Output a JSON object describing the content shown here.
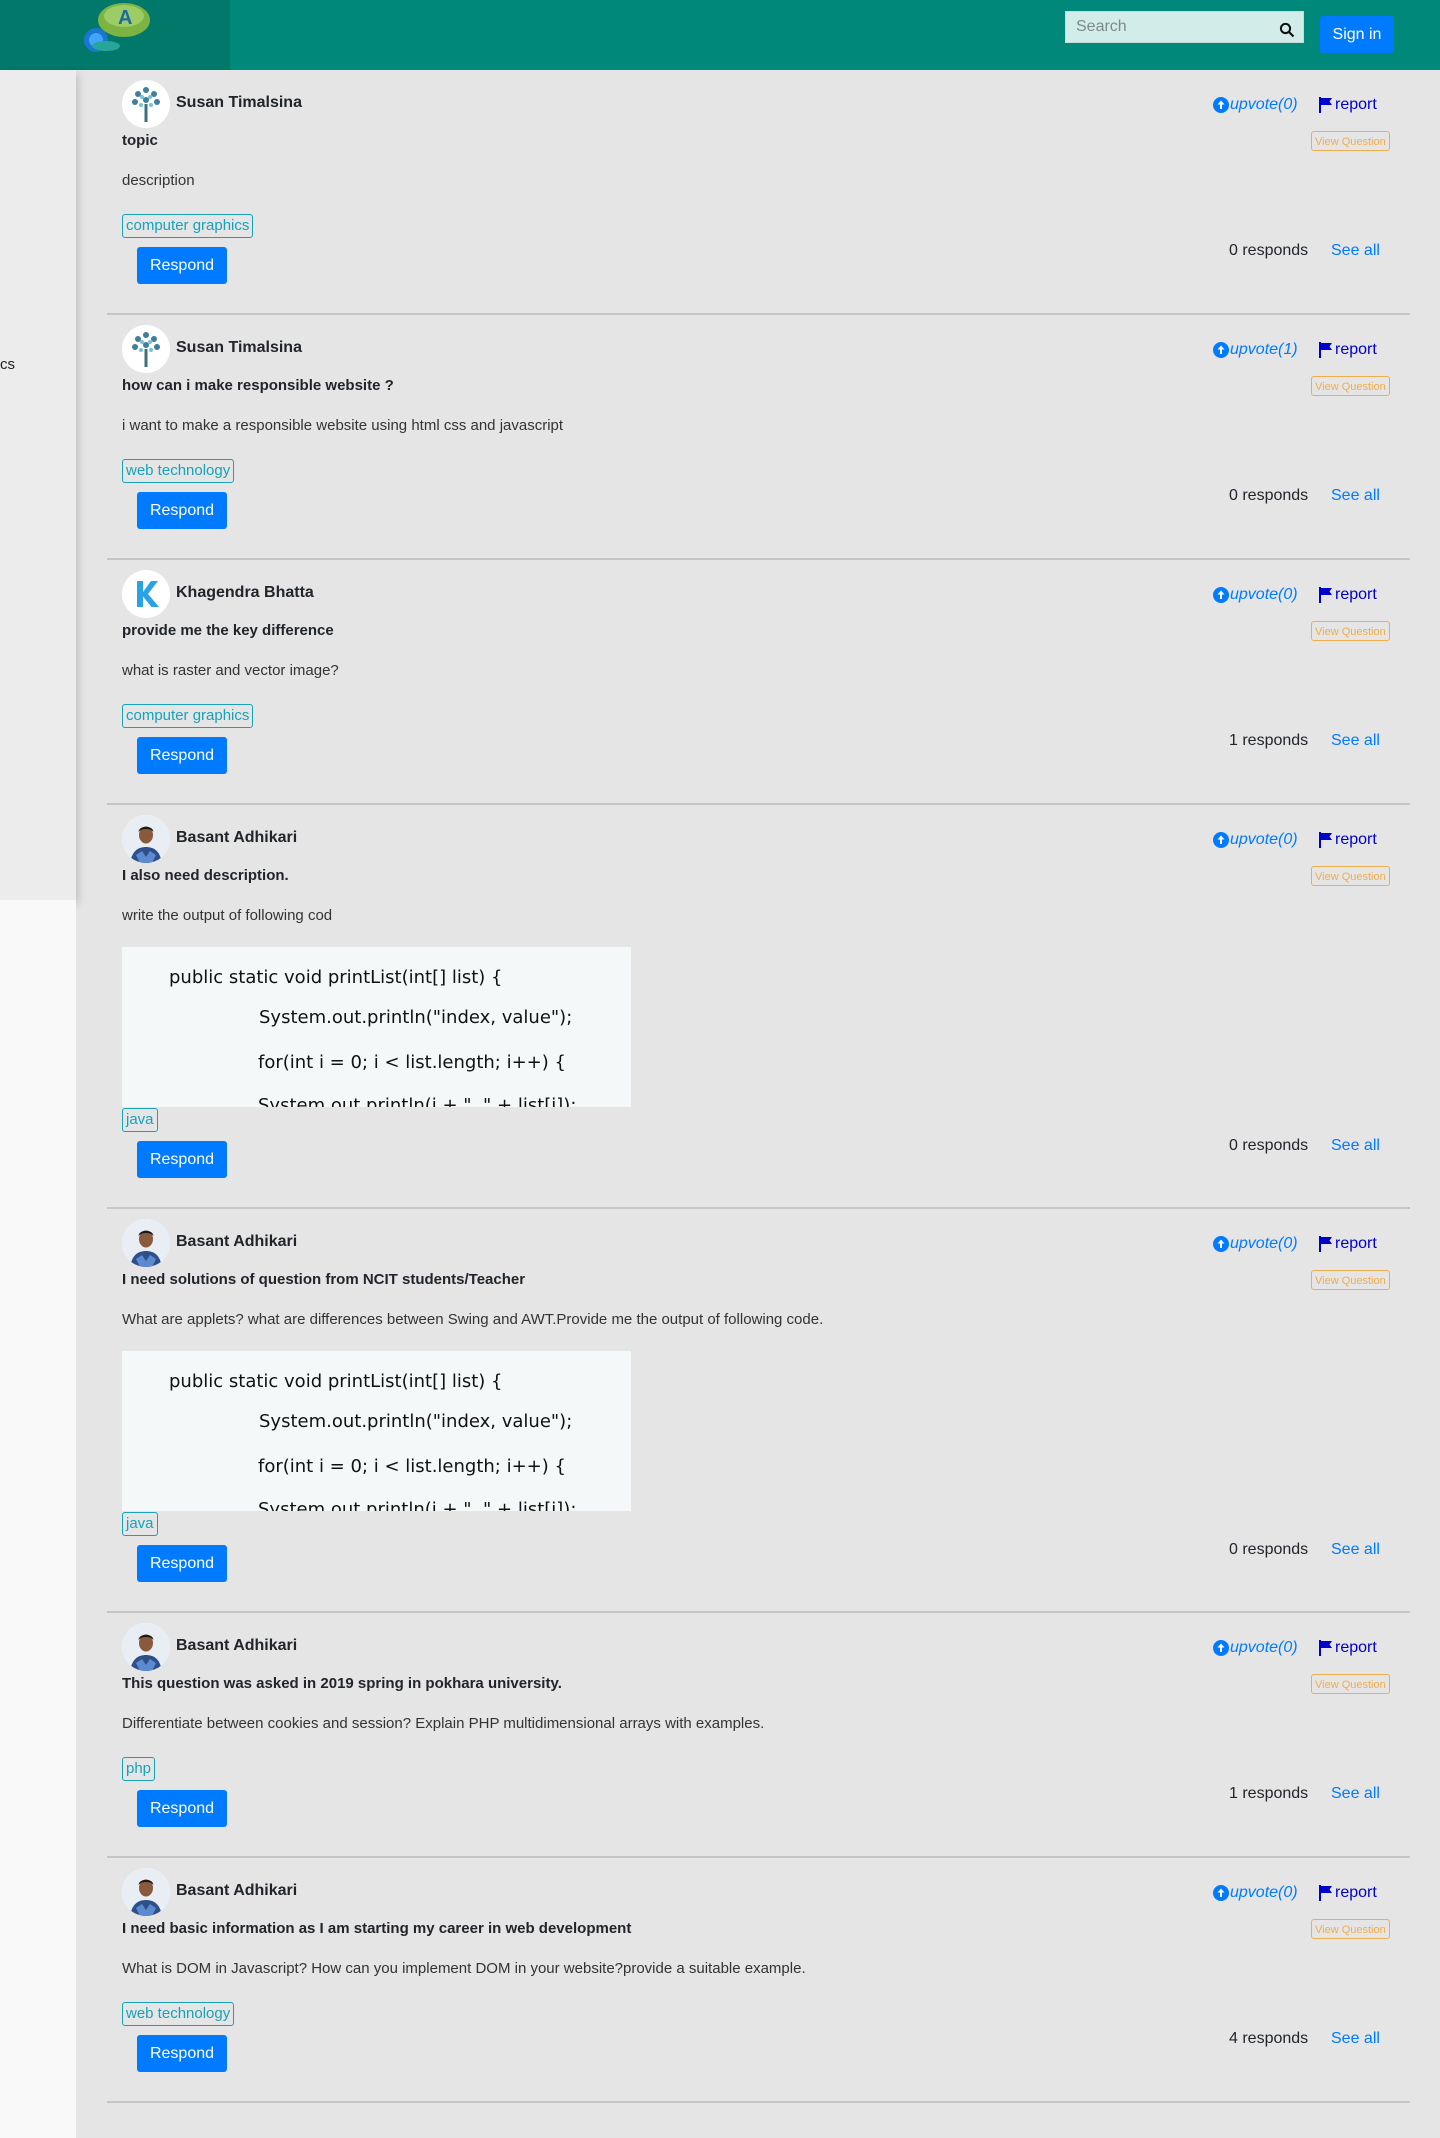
{
  "header": {
    "search_placeholder": "Search",
    "signin_label": "Sign in",
    "accent_color": "#00897b"
  },
  "sidebar": {
    "partial_text": "cs"
  },
  "code_image": {
    "lines": [
      "public static void printList(int[] list) {",
      "System.out.println(\"index, value\");",
      "for(int i = 0; i < list.length; i++) {",
      "System.out.println(i + \", \" + list[i]);"
    ]
  },
  "posts": [
    {
      "author": "Susan Timalsina",
      "upvote": "upvote(0)",
      "report": "report",
      "view": "View Question",
      "title": "topic",
      "description": "description",
      "tag": "computer graphics",
      "respond": "Respond",
      "responds": "0 responds",
      "see_all": "See all"
    },
    {
      "author": "Susan Timalsina",
      "upvote": "upvote(1)",
      "report": "report",
      "view": "View Question",
      "title": "how can i make responsible website ?",
      "description": "i want to make a responsible website using html css and javascript",
      "tag": "web technology",
      "respond": "Respond",
      "responds": "0 responds",
      "see_all": "See all"
    },
    {
      "author": "Khagendra Bhatta",
      "upvote": "upvote(0)",
      "report": "report",
      "view": "View Question",
      "title": "provide me the key difference",
      "description": "what is raster and vector image?",
      "tag": "computer graphics",
      "respond": "Respond",
      "responds": "1 responds",
      "see_all": "See all"
    },
    {
      "author": "Basant Adhikari",
      "upvote": "upvote(0)",
      "report": "report",
      "view": "View Question",
      "title": "I also need description.",
      "description": "write the output of following cod",
      "tag": "java",
      "respond": "Respond",
      "responds": "0 responds",
      "see_all": "See all"
    },
    {
      "author": "Basant Adhikari",
      "upvote": "upvote(0)",
      "report": "report",
      "view": "View Question",
      "title": "I need solutions of question from NCIT students/Teacher",
      "description": "What are applets? what are differences between Swing and AWT.Provide me the output of following code.",
      "tag": "java",
      "respond": "Respond",
      "responds": "0 responds",
      "see_all": "See all"
    },
    {
      "author": "Basant Adhikari",
      "upvote": "upvote(0)",
      "report": "report",
      "view": "View Question",
      "title": "This question was asked in 2019 spring in pokhara university.",
      "description": "Differentiate between cookies and session? Explain PHP multidimensional arrays with examples.",
      "tag": "php",
      "respond": "Respond",
      "responds": "1 responds",
      "see_all": "See all"
    },
    {
      "author": "Basant Adhikari",
      "upvote": "upvote(0)",
      "report": "report",
      "view": "View Question",
      "title": "I need basic information as I am starting my career in web development",
      "description": "What is DOM in Javascript? How can you implement DOM in your website?provide a suitable example.",
      "tag": "web technology",
      "respond": "Respond",
      "responds": "4 responds",
      "see_all": "See all"
    }
  ]
}
